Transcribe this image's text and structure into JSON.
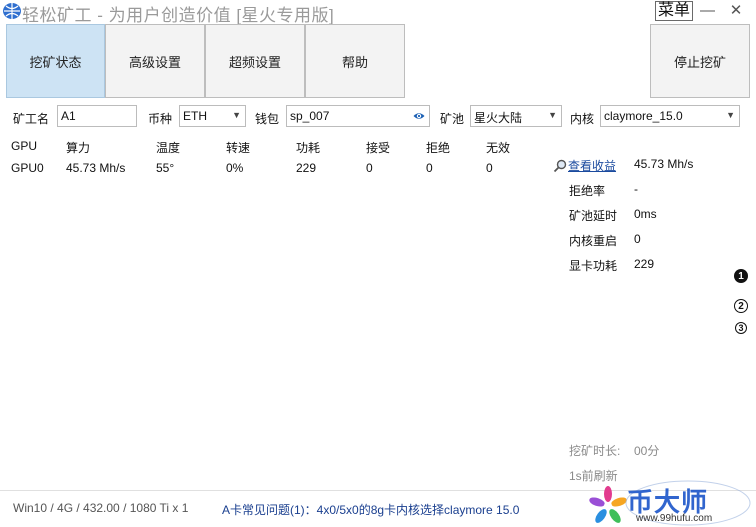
{
  "app": {
    "title": "轻松矿工 - 为用户创造价值 [星火专用版]",
    "menu_label": "菜单",
    "minimize_glyph": "—",
    "close_glyph": "✕"
  },
  "tabs": [
    {
      "label": "挖矿状态",
      "active": true
    },
    {
      "label": "高级设置",
      "active": false
    },
    {
      "label": "超频设置",
      "active": false
    },
    {
      "label": "帮助",
      "active": false
    }
  ],
  "stop_button": "停止挖矿",
  "settings": {
    "worker_label": "矿工名",
    "worker_value": "A1",
    "coin_label": "币种",
    "coin_value": "ETH",
    "wallet_label": "钱包",
    "wallet_value": "sp_007",
    "pool_label": "矿池",
    "pool_value": "星火大陆",
    "kernel_label": "内核",
    "kernel_value": "claymore_15.0"
  },
  "gpu_table": {
    "headers": [
      "GPU",
      "算力",
      "温度",
      "转速",
      "功耗",
      "接受",
      "拒绝",
      "无效"
    ],
    "rows": [
      [
        "GPU0",
        "45.73 Mh/s",
        "55°",
        "0%",
        "229",
        "0",
        "0",
        "0"
      ]
    ]
  },
  "stats": {
    "view_earnings": "查看收益",
    "hashrate_value": "45.73 Mh/s",
    "items": [
      {
        "label": "拒绝率",
        "value": "-"
      },
      {
        "label": "矿池延时",
        "value": "0ms"
      },
      {
        "label": "内核重启",
        "value": "0"
      },
      {
        "label": "显卡功耗",
        "value": "229"
      }
    ]
  },
  "pages": [
    "1",
    "2",
    "3"
  ],
  "mining_time_label": "挖矿时长:",
  "mining_time_value": "00分",
  "refresh_text": "1s前刷新",
  "footer": {
    "system_info": "Win10  / 4G / 432.00 / 1080 Ti x 1",
    "faq_link": "A卡常见问题(1)：4x0/5x0的8g卡内核选择claymore 15.0"
  },
  "watermark": {
    "text": "币大师",
    "url": "www.99hufu.com"
  },
  "colors": {
    "active_tab": "#cde3f4",
    "link": "#1a4a9e",
    "watermark": "#1b55c9"
  }
}
